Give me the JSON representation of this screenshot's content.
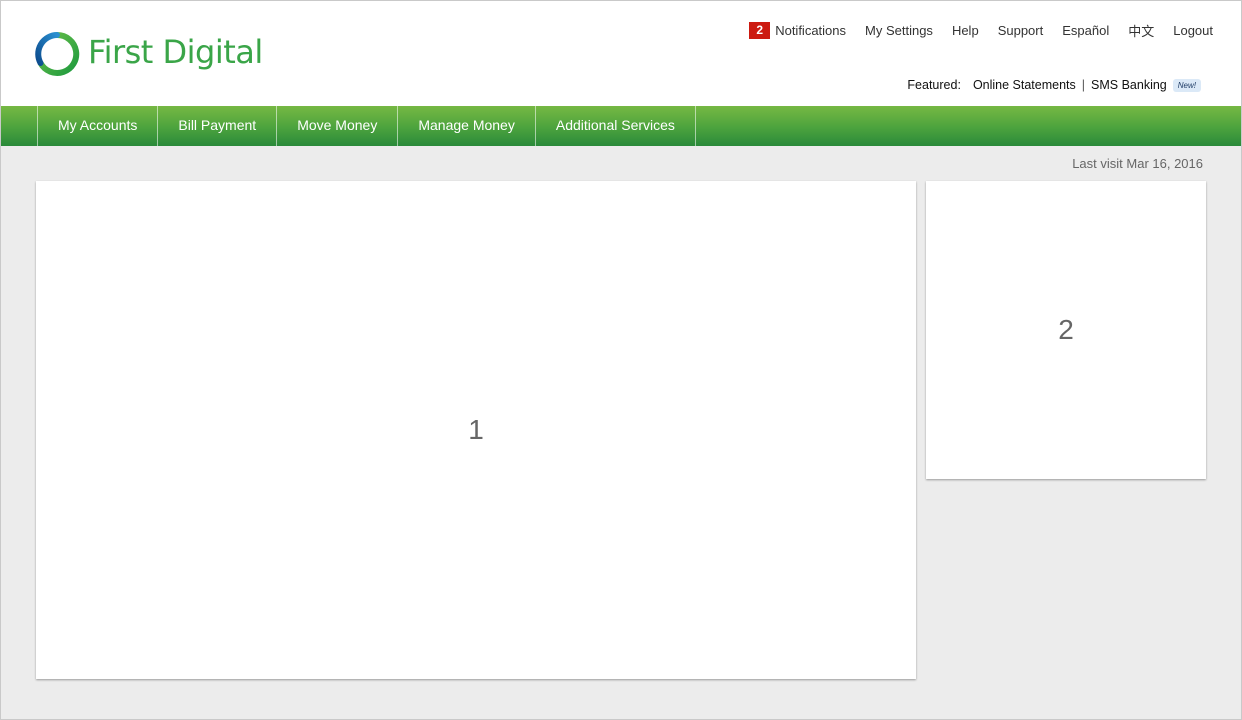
{
  "brand": {
    "name": "First Digital",
    "colors": {
      "primary_green": "#3aa548",
      "logo_blue": "#1d5fa8",
      "badge_red": "#cc1a10"
    }
  },
  "top_links": {
    "notifications_count": "2",
    "notifications_label": "Notifications",
    "settings": "My Settings",
    "help": "Help",
    "support": "Support",
    "spanish": "Español",
    "chinese": "中文",
    "logout": "Logout"
  },
  "featured": {
    "label": "Featured:",
    "items": [
      "Online Statements",
      "SMS Banking"
    ],
    "separator": "|",
    "new_badge": "New!"
  },
  "nav": {
    "items": [
      "My Accounts",
      "Bill Payment",
      "Move Money",
      "Manage Money",
      "Additional Services"
    ]
  },
  "last_visit": "Last visit Mar 16, 2016",
  "panels": {
    "main": "1",
    "side": "2"
  },
  "icons": {
    "logo": "ring-logo-icon"
  }
}
